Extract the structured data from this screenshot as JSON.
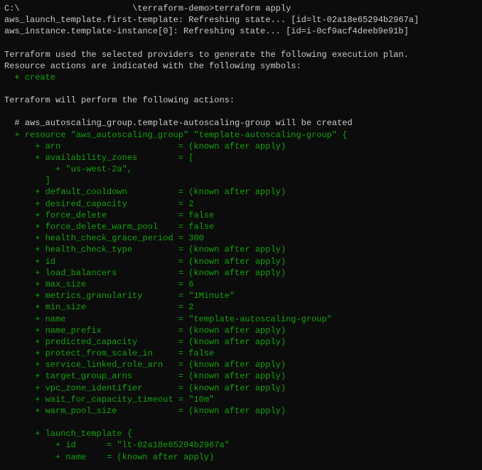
{
  "prompt": {
    "path": "C:\\                      \\terraform-demo>",
    "command": "terraform apply"
  },
  "refreshing": [
    "aws_launch_template.first-template: Refreshing state... [id=lt-02a18e65294b2967a]",
    "aws_instance.template-instance[0]: Refreshing state... [id=i-0cf9acf4deeb9e91b]"
  ],
  "plan_intro": {
    "l1": "Terraform used the selected providers to generate the following execution plan.",
    "l2": "Resource actions are indicated with the following symbols:",
    "create_symbol": "  + ",
    "create_word": "create"
  },
  "perform": "Terraform will perform the following actions:",
  "resource_comment": {
    "prefix": "  # ",
    "name": "aws_autoscaling_group.template-autoscaling-group",
    "suffix": " will be created"
  },
  "resource_open": "  + resource \"aws_autoscaling_group\" \"template-autoscaling-group\" {",
  "attrs": [
    {
      "key": "arn",
      "pad": "arn                       ",
      "val": "= (known after apply)"
    },
    {
      "key": "availability_zones",
      "pad": "availability_zones        ",
      "val": "= ["
    },
    {
      "key": "_az_item",
      "pad": "    + \"us-west-2a\",",
      "val": "",
      "raw": true
    },
    {
      "key": "_az_close",
      "pad": "  ]",
      "val": "",
      "raw": true
    },
    {
      "key": "default_cooldown",
      "pad": "default_cooldown          ",
      "val": "= (known after apply)"
    },
    {
      "key": "desired_capacity",
      "pad": "desired_capacity          ",
      "val": "= 2"
    },
    {
      "key": "force_delete",
      "pad": "force_delete              ",
      "val": "= false"
    },
    {
      "key": "force_delete_warm_pool",
      "pad": "force_delete_warm_pool    ",
      "val": "= false"
    },
    {
      "key": "health_check_grace_period",
      "pad": "health_check_grace_period ",
      "val": "= 300"
    },
    {
      "key": "health_check_type",
      "pad": "health_check_type         ",
      "val": "= (known after apply)"
    },
    {
      "key": "id",
      "pad": "id                        ",
      "val": "= (known after apply)"
    },
    {
      "key": "load_balancers",
      "pad": "load_balancers            ",
      "val": "= (known after apply)"
    },
    {
      "key": "max_size",
      "pad": "max_size                  ",
      "val": "= 6"
    },
    {
      "key": "metrics_granularity",
      "pad": "metrics_granularity       ",
      "val": "= \"1Minute\""
    },
    {
      "key": "min_size",
      "pad": "min_size                  ",
      "val": "= 2"
    },
    {
      "key": "name",
      "pad": "name                      ",
      "val": "= \"template-autoscaling-group\""
    },
    {
      "key": "name_prefix",
      "pad": "name_prefix               ",
      "val": "= (known after apply)"
    },
    {
      "key": "predicted_capacity",
      "pad": "predicted_capacity        ",
      "val": "= (known after apply)"
    },
    {
      "key": "protect_from_scale_in",
      "pad": "protect_from_scale_in     ",
      "val": "= false"
    },
    {
      "key": "service_linked_role_arn",
      "pad": "service_linked_role_arn   ",
      "val": "= (known after apply)"
    },
    {
      "key": "target_group_arns",
      "pad": "target_group_arns         ",
      "val": "= (known after apply)"
    },
    {
      "key": "vpc_zone_identifier",
      "pad": "vpc_zone_identifier       ",
      "val": "= (known after apply)"
    },
    {
      "key": "wait_for_capacity_timeout",
      "pad": "wait_for_capacity_timeout ",
      "val": "= \"10m\""
    },
    {
      "key": "warm_pool_size",
      "pad": "warm_pool_size            ",
      "val": "= (known after apply)"
    }
  ],
  "launch_template": {
    "open": "      + launch_template {",
    "id": "          + id      = \"lt-02a18e65294b2967a\"",
    "name": "          + name    = (known after apply)"
  }
}
